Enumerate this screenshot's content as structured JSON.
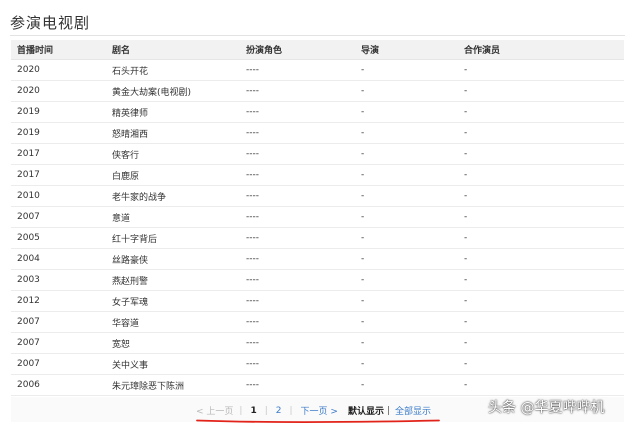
{
  "section": {
    "title": "参演电视剧"
  },
  "table": {
    "headers": [
      "首播时间",
      "剧名",
      "扮演角色",
      "导演",
      "合作演员"
    ],
    "rows": [
      [
        "2020",
        "石头开花",
        "----",
        "-",
        "-"
      ],
      [
        "2020",
        "黄金大劫案(电视剧)",
        "----",
        "-",
        "-"
      ],
      [
        "2019",
        "精英律师",
        "----",
        "-",
        "-"
      ],
      [
        "2019",
        "怒晴湘西",
        "----",
        "-",
        "-"
      ],
      [
        "2017",
        "侠客行",
        "----",
        "-",
        "-"
      ],
      [
        "2017",
        "白鹿原",
        "----",
        "-",
        "-"
      ],
      [
        "2010",
        "老牛家的战争",
        "----",
        "-",
        "-"
      ],
      [
        "2007",
        "意道",
        "----",
        "-",
        "-"
      ],
      [
        "2005",
        "红十字背后",
        "----",
        "-",
        "-"
      ],
      [
        "2004",
        "丝路豪侠",
        "----",
        "-",
        "-"
      ],
      [
        "2003",
        "燕赵刑警",
        "----",
        "-",
        "-"
      ],
      [
        "2012",
        "女子军魂",
        "----",
        "-",
        "-"
      ],
      [
        "2007",
        "华容道",
        "----",
        "-",
        "-"
      ],
      [
        "2007",
        "宽恕",
        "----",
        "-",
        "-"
      ],
      [
        "2007",
        "关中义事",
        "----",
        "-",
        "-"
      ],
      [
        "2006",
        "朱元璋除恶下陈洲",
        "----",
        "-",
        "-"
      ]
    ]
  },
  "pagination": {
    "prev_label": "< 上一页",
    "page1_label": "1",
    "page2_label": "2",
    "next_label": "下一页 >",
    "default_view_label": "默认显示",
    "show_all_label": "全部显示",
    "current_page": 1
  },
  "watermark": {
    "text": "头条 @华夏哔哔机"
  },
  "colors": {
    "link": "#3a7bc8",
    "annotation": "#e2231a",
    "header_bg": "#f2f2f2"
  }
}
